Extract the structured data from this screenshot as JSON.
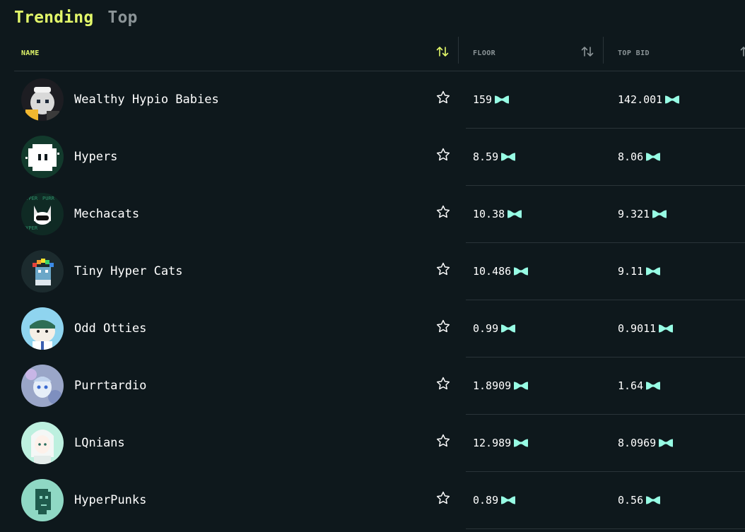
{
  "tabs": {
    "trending": "Trending",
    "top": "Top"
  },
  "columns": {
    "name": "NAME",
    "floor": "FLOOR",
    "top_bid": "TOP BID"
  },
  "colors": {
    "accent": "#e3f86a",
    "token": "#97fce4",
    "background": "#0e181c",
    "muted": "#8b9497"
  },
  "rows": [
    {
      "name": "Wealthy Hypio Babies",
      "floor": "159",
      "top_bid": "142.001"
    },
    {
      "name": "Hypers",
      "floor": "8.59",
      "top_bid": "8.06"
    },
    {
      "name": "Mechacats",
      "floor": "10.38",
      "top_bid": "9.321"
    },
    {
      "name": "Tiny Hyper Cats",
      "floor": "10.486",
      "top_bid": "9.11"
    },
    {
      "name": "Odd Otties",
      "floor": "0.99",
      "top_bid": "0.9011"
    },
    {
      "name": "Purrtardio",
      "floor": "1.8909",
      "top_bid": "1.64"
    },
    {
      "name": "LQnians",
      "floor": "12.989",
      "top_bid": "8.0969"
    },
    {
      "name": "HyperPunks",
      "floor": "0.89",
      "top_bid": "0.56"
    }
  ]
}
